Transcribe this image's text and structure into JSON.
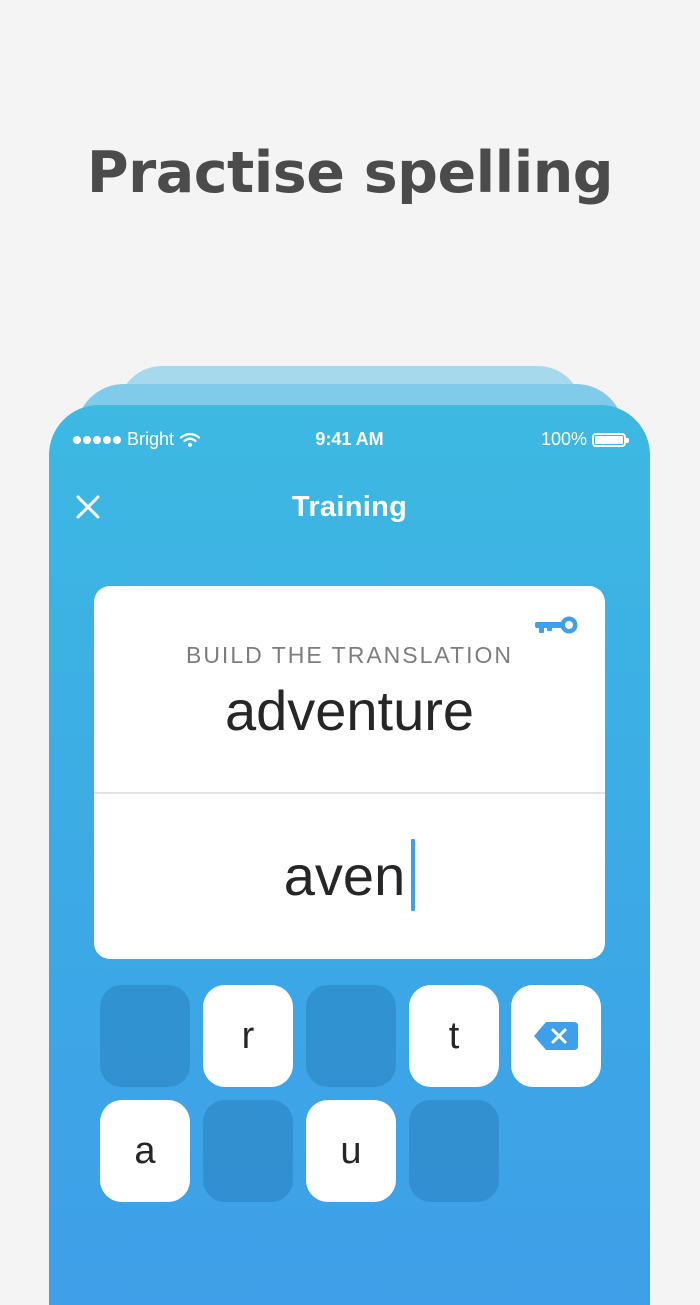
{
  "headline": "Practise spelling",
  "status_bar": {
    "carrier": "Bright",
    "time": "9:41 AM",
    "battery": "100%"
  },
  "nav": {
    "title": "Training",
    "close_icon": "close-icon"
  },
  "card": {
    "hint_icon": "key-icon",
    "prompt_label": "BUILD THE TRANSLATION",
    "prompt_word": "adventure",
    "answer": "aven"
  },
  "keyboard": {
    "row1": [
      "",
      "r",
      "",
      "t",
      "backspace"
    ],
    "row2": [
      "a",
      "",
      "u",
      ""
    ],
    "key_r": "r",
    "key_t": "t",
    "key_a": "a",
    "key_u": "u",
    "backspace_icon": "backspace-icon"
  },
  "colors": {
    "background": "#f4f4f4",
    "headline": "#4b4b4b",
    "phone_gradient_top": "#3db9e2",
    "phone_gradient_bottom": "#3f9fe8",
    "accent": "#3f9fe8"
  }
}
